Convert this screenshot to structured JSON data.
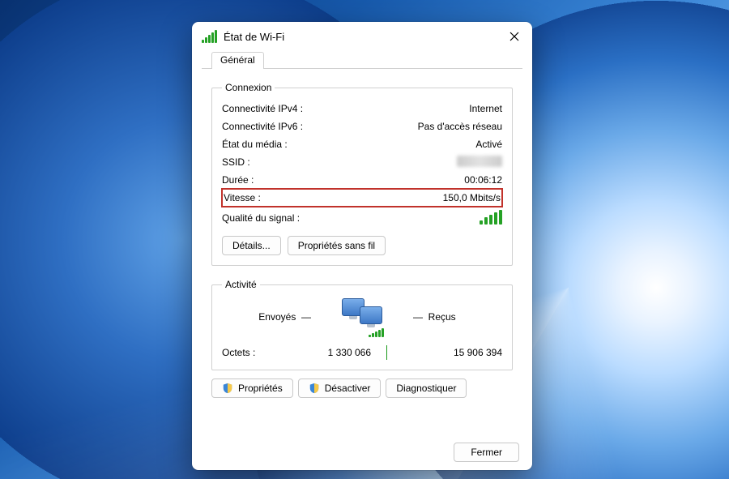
{
  "window": {
    "title": "État de Wi-Fi"
  },
  "tabs": {
    "general": "Général"
  },
  "connexion": {
    "legend": "Connexion",
    "ipv4_label": "Connectivité IPv4 :",
    "ipv4_value": "Internet",
    "ipv6_label": "Connectivité IPv6 :",
    "ipv6_value": "Pas d'accès réseau",
    "media_label": "État du média :",
    "media_value": "Activé",
    "ssid_label": "SSID :",
    "duration_label": "Durée :",
    "duration_value": "00:06:12",
    "speed_label": "Vitesse :",
    "speed_value": "150,0 Mbits/s",
    "signal_label": "Qualité du signal :",
    "details_btn": "Détails...",
    "wireless_btn": "Propriétés sans fil"
  },
  "activity": {
    "legend": "Activité",
    "sent_label": "Envoyés",
    "received_label": "Reçus",
    "bytes_label": "Octets :",
    "bytes_sent": "1 330 066",
    "bytes_received": "15 906 394"
  },
  "buttons": {
    "properties": "Propriétés",
    "disable": "Désactiver",
    "diagnose": "Diagnostiquer",
    "close": "Fermer"
  }
}
